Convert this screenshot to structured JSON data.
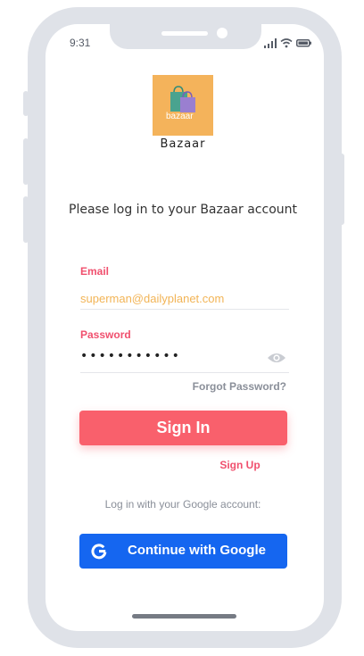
{
  "status_bar": {
    "time": "9:31",
    "icons": [
      "signal-icon",
      "wifi-icon",
      "battery-icon"
    ]
  },
  "logo": {
    "wordmark": "bazaar",
    "icon": "shopping-bags-icon"
  },
  "app_name": "Bazaar",
  "login_prompt": "Please log in to your Bazaar account",
  "form": {
    "email_label": "Email",
    "email_value": "superman@dailyplanet.com",
    "password_label": "Password",
    "password_value": "•••••••••••",
    "password_toggle_icon": "eye-icon",
    "forgot_password": "Forgot Password?"
  },
  "actions": {
    "sign_in": "Sign In",
    "sign_up": "Sign Up"
  },
  "google": {
    "prompt": "Log in with your Google account:",
    "button_label": "Continue with Google",
    "icon": "google-g-icon"
  },
  "colors": {
    "accent": "#f9606c",
    "label": "#f0506e",
    "email_text": "#f2b456",
    "google_blue": "#1566f0",
    "logo_bg": "#f4b35b",
    "frame": "#dfe2e8"
  }
}
